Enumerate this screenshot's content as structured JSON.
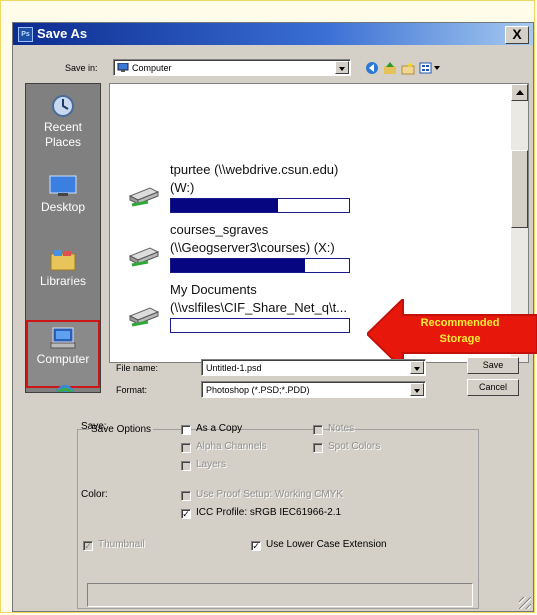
{
  "window": {
    "title": "Save As",
    "close_label": "X"
  },
  "toolbar": {
    "save_in_label": "Save in:",
    "save_in_value": "Computer",
    "icons": [
      "back-icon",
      "up-folder-icon",
      "new-folder-icon",
      "view-menu-icon"
    ]
  },
  "places": [
    {
      "label": "Recent Places",
      "icon": "recent-places-icon"
    },
    {
      "label": "Desktop",
      "icon": "desktop-icon"
    },
    {
      "label": "Libraries",
      "icon": "libraries-icon"
    },
    {
      "label": "Computer",
      "icon": "computer-icon",
      "selected": true
    }
  ],
  "drives": [
    {
      "line1": "tpurtee (\\\\webdrive.csun.edu)",
      "line2": "(W:)",
      "usage": 0.6
    },
    {
      "line1": "courses_sgraves",
      "line2": "(\\\\Geogserver3\\courses) (X:)",
      "usage": 0.75
    },
    {
      "line1": "My Documents",
      "line2": "(\\\\vslfiles\\CIF_Share_Net_q\\t...",
      "usage": 0.0
    }
  ],
  "callout": {
    "line1": "Recommended",
    "line2": "Storage",
    "color": "#e8170c",
    "text_color": "#ffee33"
  },
  "file_name": {
    "label": "File name:",
    "value": "Untitled-1.psd"
  },
  "format": {
    "label": "Format:",
    "value": "Photoshop (*.PSD;*.PDD)"
  },
  "buttons": {
    "save": "Save",
    "cancel": "Cancel"
  },
  "save_options": {
    "title": "Save Options",
    "save_label": "Save:",
    "as_a_copy": "As a Copy",
    "notes": "Notes",
    "alpha_channels": "Alpha Channels",
    "spot_colors": "Spot Colors",
    "layers": "Layers",
    "color_label": "Color:",
    "use_proof_setup": "Use Proof Setup:  Working CMYK",
    "icc_profile": "ICC Profile:  sRGB IEC61966-2.1",
    "thumbnail": "Thumbnail",
    "use_lower_case": "Use Lower Case Extension"
  }
}
